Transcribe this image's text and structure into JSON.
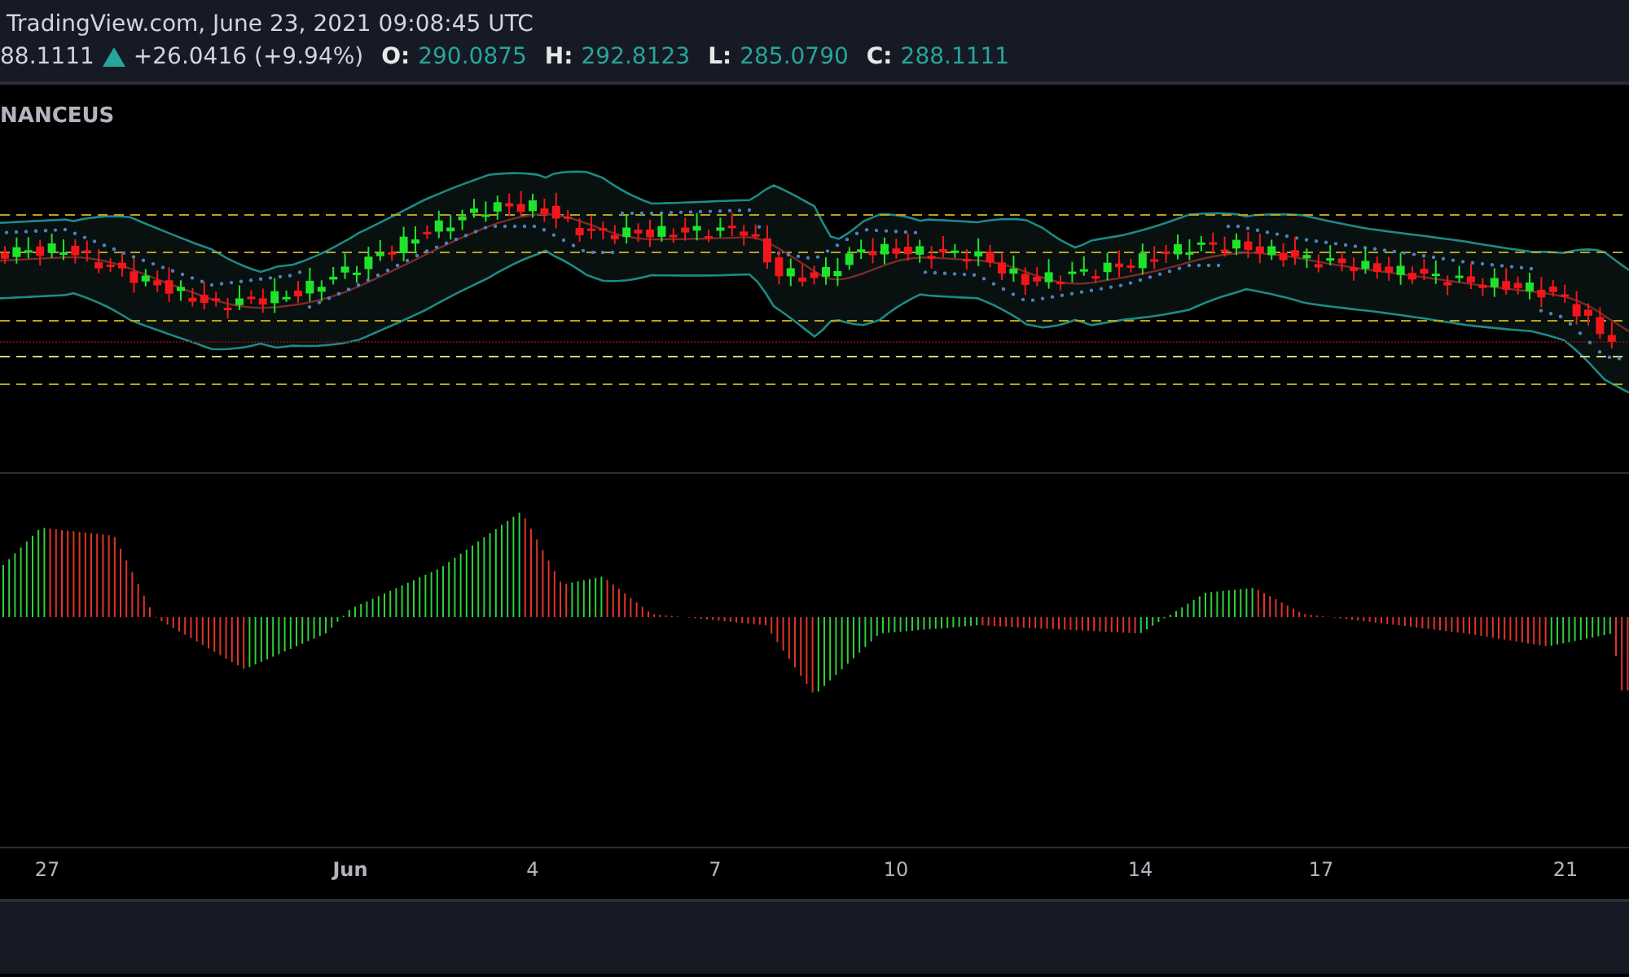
{
  "header": {
    "source_line": "TradingView.com, June 23, 2021 09:08:45 UTC",
    "last_price": "88.1111",
    "rising": true,
    "change": "+26.0416 (+9.94%)",
    "ohlc": [
      {
        "label": "O:",
        "value": "290.0875"
      },
      {
        "label": "H:",
        "value": "292.8123"
      },
      {
        "label": "L:",
        "value": "285.0790"
      },
      {
        "label": "C:",
        "value": "288.1111"
      }
    ]
  },
  "chart": {
    "symbol_label": "NANCEUS"
  },
  "time_axis": {
    "labels": [
      {
        "text": "27",
        "kind": "day"
      },
      {
        "text": "Jun",
        "kind": "month"
      },
      {
        "text": "4",
        "kind": "day"
      },
      {
        "text": "7",
        "kind": "day"
      },
      {
        "text": "10",
        "kind": "day"
      },
      {
        "text": "14",
        "kind": "day"
      },
      {
        "text": "17",
        "kind": "day"
      },
      {
        "text": "21",
        "kind": "day"
      }
    ]
  }
}
